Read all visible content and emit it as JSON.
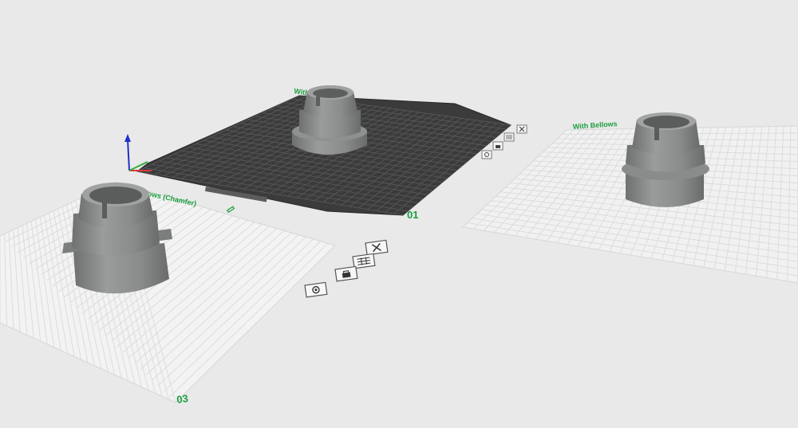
{
  "plates": [
    {
      "id": "plate-1",
      "title": "With Bellows",
      "number": "01",
      "style": "dark-textured"
    },
    {
      "id": "plate-2",
      "title": "With Bellows",
      "number": "",
      "style": "light"
    },
    {
      "id": "plate-3",
      "title": "...llows (Chamfer)",
      "number": "03",
      "style": "light"
    }
  ],
  "plate_toolbar": {
    "icons": [
      "close-icon",
      "arrange-icon",
      "lock-icon",
      "slice-settings-icon"
    ]
  },
  "axes": {
    "x_color": "#d83a3a",
    "y_color": "#2fae3a",
    "z_color": "#2230c8"
  },
  "colors": {
    "accent": "#1a9e3f",
    "model": "#8a8c8c",
    "bed_dark": "#3a3a3a",
    "bed_light": "#f2f2f2"
  }
}
